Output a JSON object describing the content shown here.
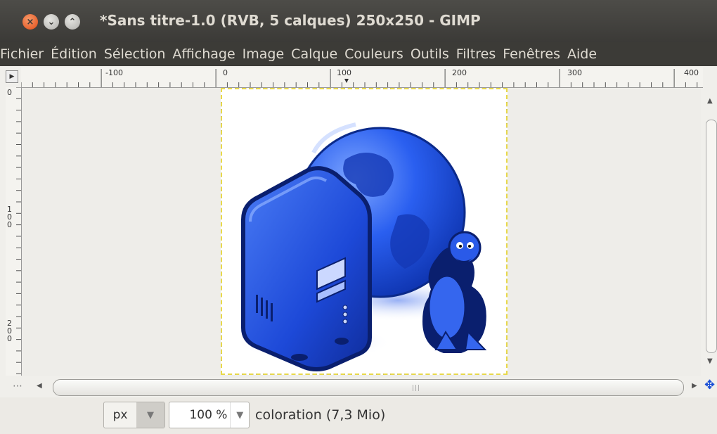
{
  "window": {
    "title": "*Sans titre-1.0 (RVB, 5 calques) 250x250 - GIMP",
    "close_glyph": "×",
    "min_glyph": "⌄",
    "max_glyph": "⌃"
  },
  "menubar": {
    "items": [
      "Fichier",
      "Édition",
      "Sélection",
      "Affichage",
      "Image",
      "Calque",
      "Couleurs",
      "Outils",
      "Filtres",
      "Fenêtres",
      "Aide"
    ]
  },
  "rulers": {
    "horizontal_labels": [
      "-100",
      "0",
      "100",
      "200",
      "300",
      "400"
    ],
    "vertical_labels": [
      "0",
      "1\n0\n0",
      "2\n0\n0"
    ]
  },
  "statusbar": {
    "unit": "px",
    "zoom": "100 %",
    "message": "coloration (7,3 Mio)"
  },
  "icons": {
    "navigate": "✥",
    "quickmask": "⋯",
    "scroll_left": "◀",
    "scroll_right": "▶",
    "scroll_up": "▲",
    "scroll_down": "▼",
    "dropdown": "▼",
    "ruler_menu": "▶"
  },
  "colors": {
    "accent_blue": "#1a4fd6",
    "dark_blue": "#0a1f6e",
    "title_bg": "#3c3b37"
  }
}
